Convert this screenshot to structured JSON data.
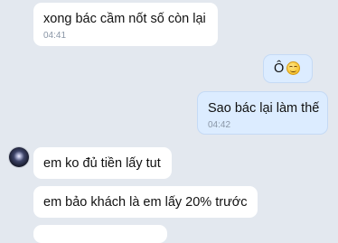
{
  "messages": [
    {
      "text": "xong bác cầm nốt số còn lại",
      "time": "04:41",
      "direction": "incoming"
    },
    {
      "text": "Ô",
      "emoji": "smiling-face-emoji",
      "direction": "outgoing"
    },
    {
      "text": "Sao bác lại làm thế",
      "time": "04:42",
      "direction": "outgoing"
    },
    {
      "text": "em ko đủ tiền lấy tut",
      "direction": "incoming"
    },
    {
      "text": "em bảo khách là em lấy 20% trước",
      "direction": "incoming"
    }
  ],
  "colors": {
    "background": "#e3e8ef",
    "incoming_bubble": "#ffffff",
    "outgoing_bubble": "#dcecff",
    "timestamp": "#8a96a6"
  }
}
